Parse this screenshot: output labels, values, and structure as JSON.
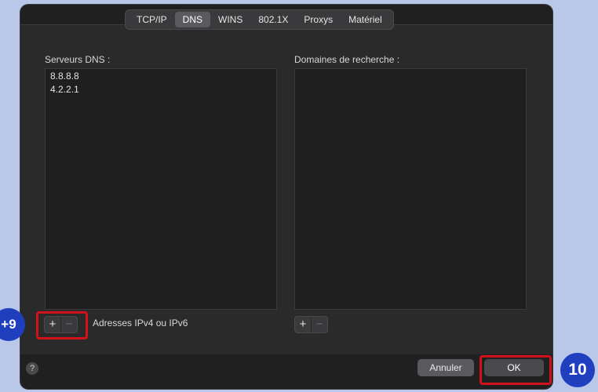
{
  "tabs": [
    {
      "label": "TCP/IP",
      "active": false
    },
    {
      "label": "DNS",
      "active": true
    },
    {
      "label": "WINS",
      "active": false
    },
    {
      "label": "802.1X",
      "active": false
    },
    {
      "label": "Proxys",
      "active": false
    },
    {
      "label": "Matériel",
      "active": false
    }
  ],
  "dns": {
    "title": "Serveurs DNS :",
    "servers": [
      "8.8.8.8",
      "4.2.2.1"
    ],
    "hint": "Adresses IPv4 ou IPv6",
    "add_label": "+",
    "remove_label": "−"
  },
  "search": {
    "title": "Domaines de recherche :",
    "add_label": "+",
    "remove_label": "−"
  },
  "help_label": "?",
  "buttons": {
    "cancel_label": "Annuler",
    "ok_label": "OK"
  },
  "annotations": {
    "step_left": "+9",
    "step_right": "10"
  },
  "colors": {
    "window_bg": "#202021",
    "highlight": "#d3111a",
    "badge": "#1f3fbf",
    "page_bg": "#b9c8e8"
  }
}
